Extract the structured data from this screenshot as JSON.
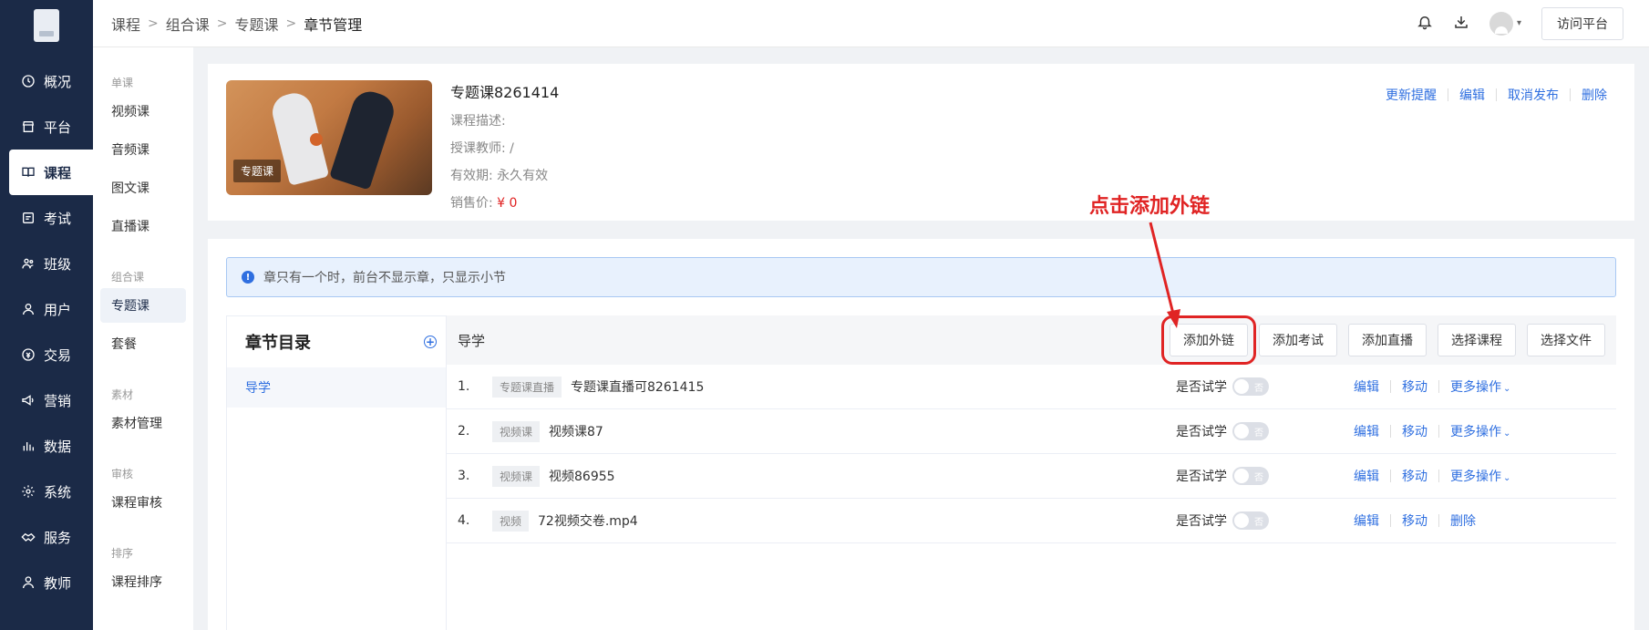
{
  "nav": {
    "items": [
      {
        "label": "概况",
        "icon": "clock-icon"
      },
      {
        "label": "平台",
        "icon": "store-icon"
      },
      {
        "label": "课程",
        "icon": "book-icon",
        "active": true
      },
      {
        "label": "考试",
        "icon": "exam-icon"
      },
      {
        "label": "班级",
        "icon": "group-icon"
      },
      {
        "label": "用户",
        "icon": "user-icon"
      },
      {
        "label": "交易",
        "icon": "trade-icon"
      },
      {
        "label": "营销",
        "icon": "megaphone-icon"
      },
      {
        "label": "数据",
        "icon": "bar-chart-icon"
      },
      {
        "label": "系统",
        "icon": "gear-icon"
      },
      {
        "label": "服务",
        "icon": "handshake-icon"
      },
      {
        "label": "教师",
        "icon": "teacher-icon"
      }
    ]
  },
  "subnav": {
    "groups": [
      {
        "title": "单课",
        "items": [
          "视频课",
          "音频课",
          "图文课",
          "直播课"
        ]
      },
      {
        "title": "组合课",
        "items": [
          "专题课",
          "套餐"
        ]
      },
      {
        "title": "素材",
        "items": [
          "素材管理"
        ]
      },
      {
        "title": "审核",
        "items": [
          "课程审核"
        ]
      },
      {
        "title": "排序",
        "items": [
          "课程排序"
        ]
      }
    ]
  },
  "breadcrumb": [
    "课程",
    "组合课",
    "专题课",
    "章节管理"
  ],
  "header": {
    "visit_label": "访问平台"
  },
  "course": {
    "tag": "专题课",
    "title": "专题课8261414",
    "desc_label": "课程描述:",
    "teacher_label": "授课教师: /",
    "validity_label": "有效期: 永久有效",
    "price_label": "销售价:",
    "price_value": "¥ 0",
    "actions": [
      "更新提醒",
      "编辑",
      "取消发布",
      "删除"
    ]
  },
  "notice": "章只有一个时，前台不显示章，只显示小节",
  "tree": {
    "title": "章节目录",
    "items": [
      "导学"
    ]
  },
  "section": {
    "title": "导学",
    "buttons": [
      "添加外链",
      "添加考试",
      "添加直播",
      "选择课程",
      "选择文件"
    ]
  },
  "rows": [
    {
      "idx": "1.",
      "type": "专题课直播",
      "name": "专题课直播可8261415",
      "trial_label": "是否试学",
      "switch_text": "否",
      "actions": [
        "编辑",
        "移动",
        "更多操作"
      ]
    },
    {
      "idx": "2.",
      "type": "视频课",
      "name": "视频课87",
      "trial_label": "是否试学",
      "switch_text": "否",
      "actions": [
        "编辑",
        "移动",
        "更多操作"
      ]
    },
    {
      "idx": "3.",
      "type": "视频课",
      "name": "视频86955",
      "trial_label": "是否试学",
      "switch_text": "否",
      "actions": [
        "编辑",
        "移动",
        "更多操作"
      ]
    },
    {
      "idx": "4.",
      "type": "视频",
      "name": "72视频交卷.mp4",
      "trial_label": "是否试学",
      "switch_text": "否",
      "actions": [
        "编辑",
        "移动",
        "删除"
      ]
    }
  ],
  "annotation": {
    "text": "点击添加外链",
    "color": "#e02424"
  }
}
